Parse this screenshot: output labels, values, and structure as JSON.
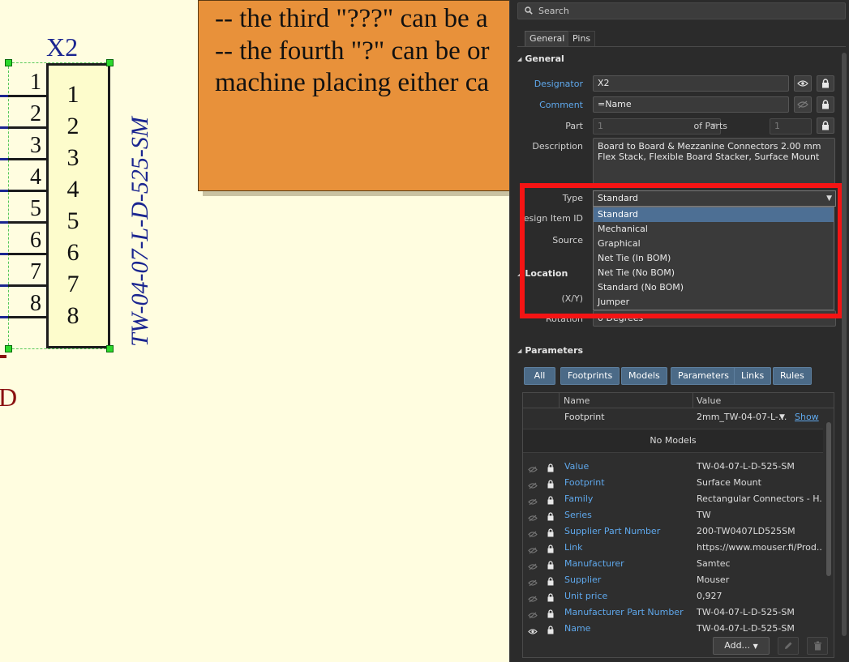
{
  "canvas": {
    "designator": "X2",
    "comment": "TW-04-07-L-D-525-SM",
    "pins": [
      {
        "number": "1",
        "name": "1"
      },
      {
        "number": "2",
        "name": "2"
      },
      {
        "number": "3",
        "name": "3"
      },
      {
        "number": "4",
        "name": "4"
      },
      {
        "number": "5",
        "name": "5"
      },
      {
        "number": "6",
        "name": "6"
      },
      {
        "number": "7",
        "name": "7"
      },
      {
        "number": "8",
        "name": "8"
      }
    ],
    "cut_text": "D",
    "note_lines": [
      "-- the third \"???\" can be a",
      "-- the fourth \"?\" can be or",
      "machine placing either ca"
    ]
  },
  "panel": {
    "search_placeholder": "Search",
    "tabs": [
      "General",
      "Pins"
    ],
    "general": {
      "title": "General",
      "designator_label": "Designator",
      "designator_value": "X2",
      "comment_label": "Comment",
      "comment_value": "=Name",
      "part_label": "Part",
      "part_value": "1",
      "of_parts_label": "of Parts",
      "of_parts_value": "1",
      "description_label": "Description",
      "description_value": "Board to Board & Mezzanine Connectors 2.00 mm Flex Stack, Flexible Board Stacker, Surface Mount",
      "type_label": "Type",
      "type_value": "Standard",
      "design_item_label": "esign Item ID",
      "source_label": "Source"
    },
    "type_options": [
      "Standard",
      "Mechanical",
      "Graphical",
      "Net Tie (In BOM)",
      "Net Tie (No BOM)",
      "Standard (No BOM)",
      "Jumper"
    ],
    "location": {
      "title": "Location",
      "xy_label": "(X/Y)",
      "rotation_label": "Rotation",
      "rotation_value": "0 Degrees"
    },
    "parameters": {
      "title": "Parameters",
      "filters": [
        "All",
        "Footprints",
        "Models",
        "Parameters",
        "Links",
        "Rules"
      ],
      "columns": [
        "Name",
        "Value"
      ],
      "footprint_name": "Footprint",
      "footprint_value": "2mm_TW-04-07-L-...",
      "show_label": "Show",
      "no_models": "No Models",
      "rows": [
        {
          "name": "Value",
          "value": "TW-04-07-L-D-525-SM"
        },
        {
          "name": "Footprint",
          "value": "Surface Mount"
        },
        {
          "name": "Family",
          "value": "Rectangular Connectors - H..."
        },
        {
          "name": "Series",
          "value": "TW"
        },
        {
          "name": "Supplier Part Number",
          "value": "200-TW0407LD525SM"
        },
        {
          "name": "Link",
          "value": "https://www.mouser.fi/Prod..."
        },
        {
          "name": "Manufacturer",
          "value": "Samtec"
        },
        {
          "name": "Supplier",
          "value": "Mouser"
        },
        {
          "name": "Unit price",
          "value": "0,927"
        },
        {
          "name": "Manufacturer Part Number",
          "value": "TW-04-07-L-D-525-SM"
        },
        {
          "name": "Name",
          "value": "TW-04-07-L-D-525-SM"
        }
      ],
      "add_label": "Add..."
    }
  },
  "colors": {
    "canvas_bg": "#fffde0",
    "note_bg": "#e8913a",
    "panel_bg": "#2b2b2b",
    "link_blue": "#5fa8ec",
    "selected_option": "#4d6f94",
    "highlight_red": "#f51414",
    "schematic_blue": "#1a2590"
  }
}
